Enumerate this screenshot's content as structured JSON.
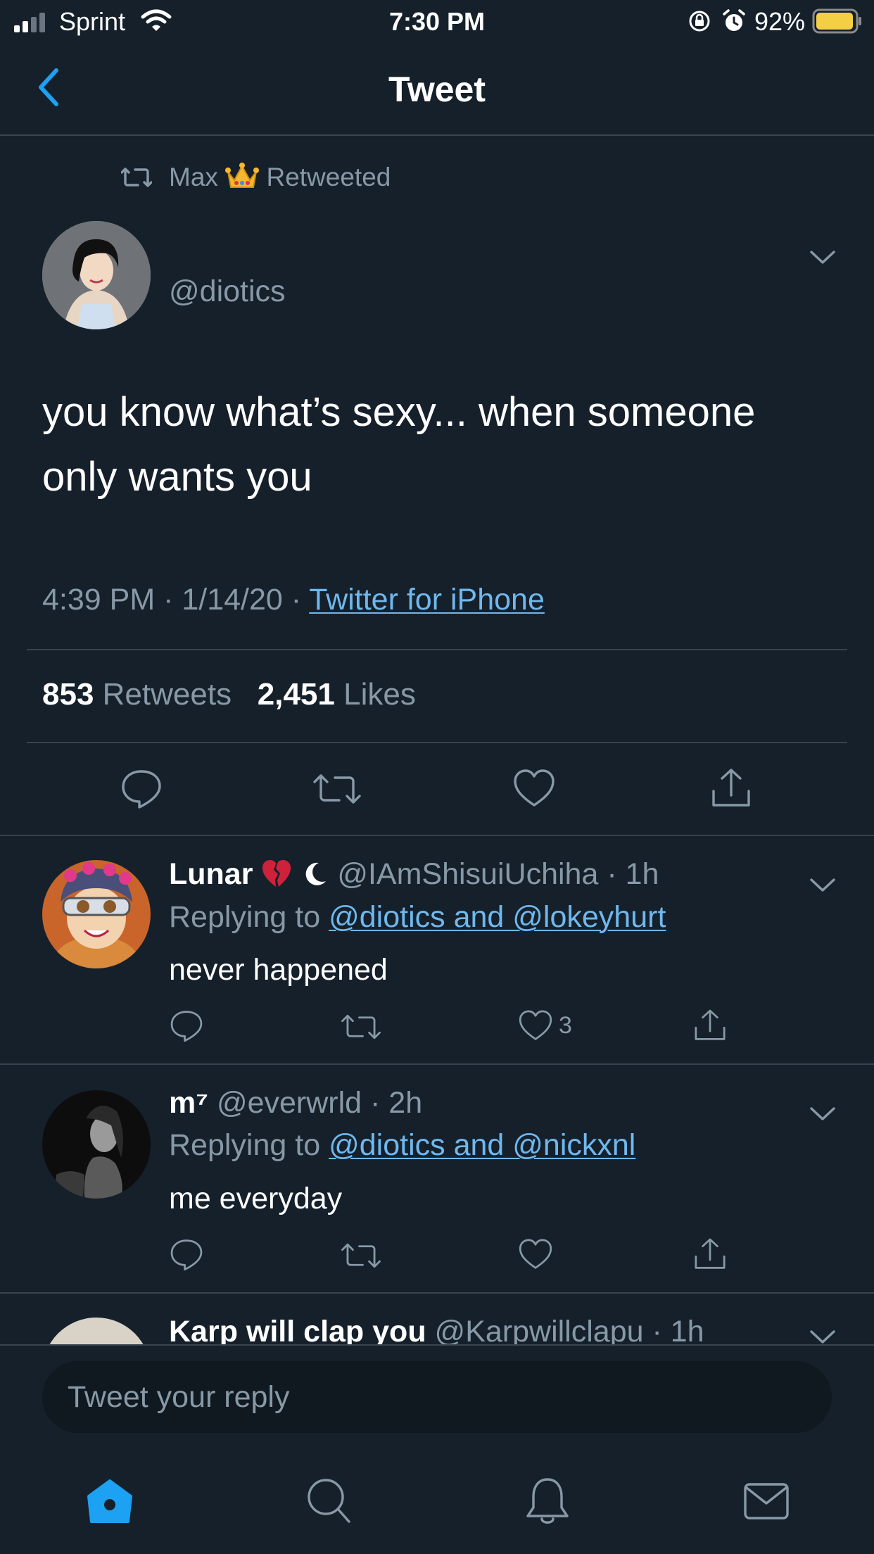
{
  "status_bar": {
    "carrier": "Sprint",
    "time": "7:30 PM",
    "battery": "92%"
  },
  "header": {
    "title": "Tweet"
  },
  "tweet": {
    "retweeted_by": "Max",
    "retweeted_label": "Retweeted",
    "handle": "@diotics",
    "text": "you know what’s sexy... when someone only wants you",
    "time": "4:39 PM",
    "date": "1/14/20",
    "source": "Twitter for iPhone",
    "retweets_count": "853",
    "retweets_label": "Retweets",
    "likes_count": "2,451",
    "likes_label": "Likes"
  },
  "replies": [
    {
      "name": "Lunar",
      "handle": "@IAmShisuiUchiha",
      "age": "1h",
      "replying_label": "Replying to",
      "replying_to": "@diotics and @lokeyhurt",
      "text": "never happened",
      "like_count": "3"
    },
    {
      "name": "m⁷",
      "handle": "@everwrld",
      "age": "2h",
      "replying_label": "Replying to",
      "replying_to": "@diotics and @nickxnl",
      "text": "me everyday"
    },
    {
      "name": "Karp will clap you",
      "handle": "@Karpwillclapu",
      "age": "1h"
    }
  ],
  "composer": {
    "placeholder": "Tweet your reply"
  },
  "tab_bar": {
    "active": "home"
  },
  "colors": {
    "background": "#15202b",
    "accent": "#1da1f2",
    "link": "#6fb8ee",
    "muted": "#8899a6",
    "divider": "#38444d"
  },
  "icons": [
    "signal-icon",
    "wifi-icon",
    "orientation-lock-icon",
    "alarm-icon",
    "battery-icon",
    "back-chevron-icon",
    "retweet-icon",
    "reply-icon",
    "like-icon",
    "share-icon",
    "chevron-down-icon",
    "home-icon",
    "search-icon",
    "notifications-icon",
    "messages-icon"
  ]
}
